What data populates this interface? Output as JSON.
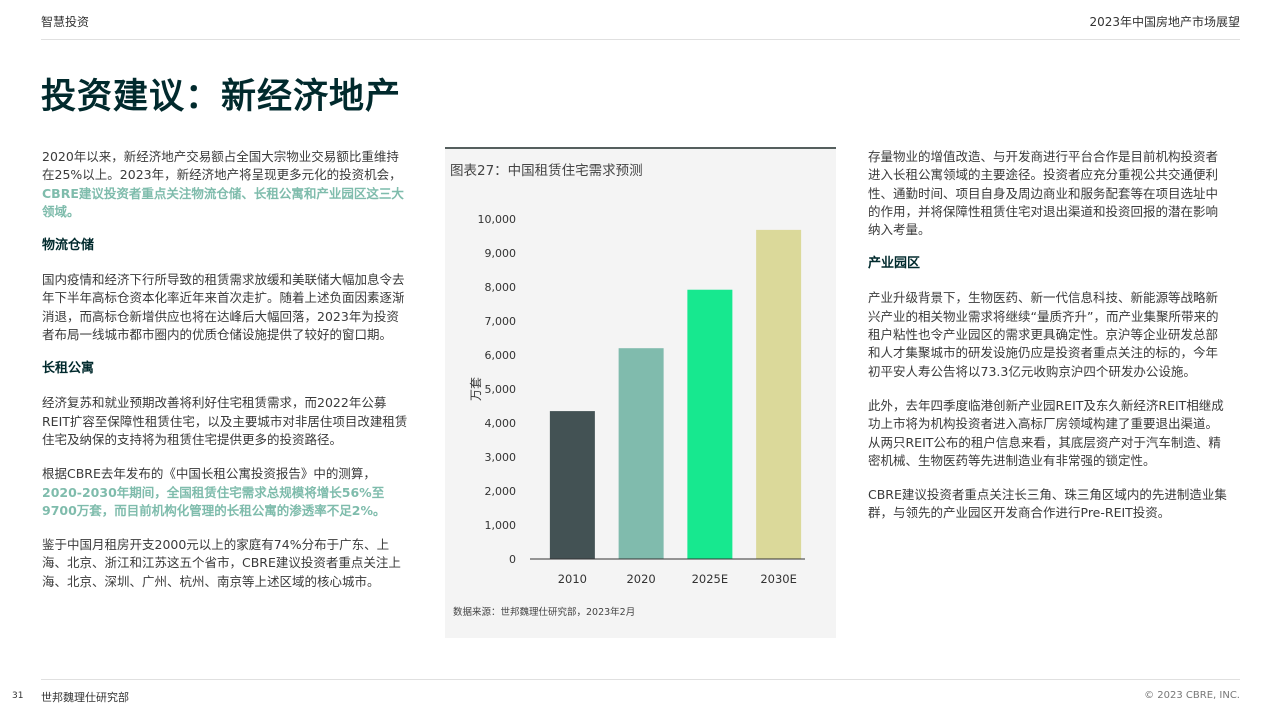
{
  "header": {
    "section": "智慧投资",
    "report": "2023年中国房地产市场展望"
  },
  "title": "投资建议：新经济地产",
  "left": {
    "intro_text": "2020年以来，新经济地产交易额占全国大宗物业交易额比重维持在25%以上。2023年，新经济地产将呈现更多元化的投资机会，",
    "intro_highlight": "CBRE建议投资者重点关注物流仓储、长租公寓和产业园区这三大领域。",
    "logistics_heading": "物流仓储",
    "logistics_text": "国内疫情和经济下行所导致的租赁需求放缓和美联储大幅加息令去年下半年高标仓资本化率近年来首次走扩。随着上述负面因素逐渐消退，而高标仓新增供应也将在达峰后大幅回落，2023年为投资者布局一线城市都市圈内的优质仓储设施提供了较好的窗口期。",
    "apartment_heading": "长租公寓",
    "apartment_text1": "经济复苏和就业预期改善将利好住宅租赁需求，而2022年公募REIT扩容至保障性租赁住宅，以及主要城市对非居住项目改建租赁住宅及纳保的支持将为租赁住宅提供更多的投资路径。",
    "apartment_text2": "根据CBRE去年发布的《中国长租公寓投资报告》中的测算，",
    "apartment_highlight": "2020-2030年期间，全国租赁住宅需求总规模将增长56%至9700万套，而目前机构化管理的长租公寓的渗透率不足2%。",
    "apartment_text3": "鉴于中国月租房开支2000元以上的家庭有74%分布于广东、上海、北京、浙江和江苏这五个省市，CBRE建议投资者重点关注上海、北京、深圳、广州、杭州、南京等上述区域的核心城市。"
  },
  "right": {
    "continued_text": "存量物业的增值改造、与开发商进行平台合作是目前机构投资者进入长租公寓领域的主要途径。投资者应充分重视公共交通便利性、通勤时间、项目自身及周边商业和服务配套等在项目选址中的作用，并将保障性租赁住宅对退出渠道和投资回报的潜在影响纳入考量。",
    "park_heading": "产业园区",
    "park_text1": "产业升级背景下，生物医药、新一代信息科技、新能源等战略新兴产业的相关物业需求将继续“量质齐升”，而产业集聚所带来的租户粘性也令产业园区的需求更具确定性。京沪等企业研发总部和人才集聚城市的研发设施仍应是投资者重点关注的标的，今年初平安人寿公告将以73.3亿元收购京沪四个研发办公设施。",
    "park_text2": "此外，去年四季度临港创新产业园REIT及东久新经济REIT相继成功上市将为机构投资者进入高标厂房领域构建了重要退出渠道。从两只REIT公布的租户信息来看，其底层资产对于汽车制造、精密机械、生物医药等先进制造业有非常强的锁定性。",
    "park_text3": "CBRE建议投资者重点关注长三角、珠三角区域内的先进制造业集群，与领先的产业园区开发商合作进行Pre-REIT投资。"
  },
  "chart_data": {
    "type": "bar",
    "title": "图表27：中国租赁住宅需求预测",
    "categories": [
      "2010",
      "2020",
      "2025E",
      "2030E"
    ],
    "values": [
      4350,
      6200,
      7920,
      9680
    ],
    "colors": [
      "#435254",
      "#80bbad",
      "#17e88f",
      "#dbd99a"
    ],
    "ylabel": "万套",
    "xlabel": "",
    "ylim": [
      0,
      10000
    ],
    "yticks": [
      "0",
      "1,000",
      "2,000",
      "3,000",
      "4,000",
      "5,000",
      "6,000",
      "7,000",
      "8,000",
      "9,000",
      "10,000"
    ],
    "source": "数据来源：世邦魏理仕研究部，2023年2月"
  },
  "footer": {
    "page": "31",
    "org": "世邦魏理仕研究部",
    "copyright": "© 2023 CBRE, INC."
  }
}
